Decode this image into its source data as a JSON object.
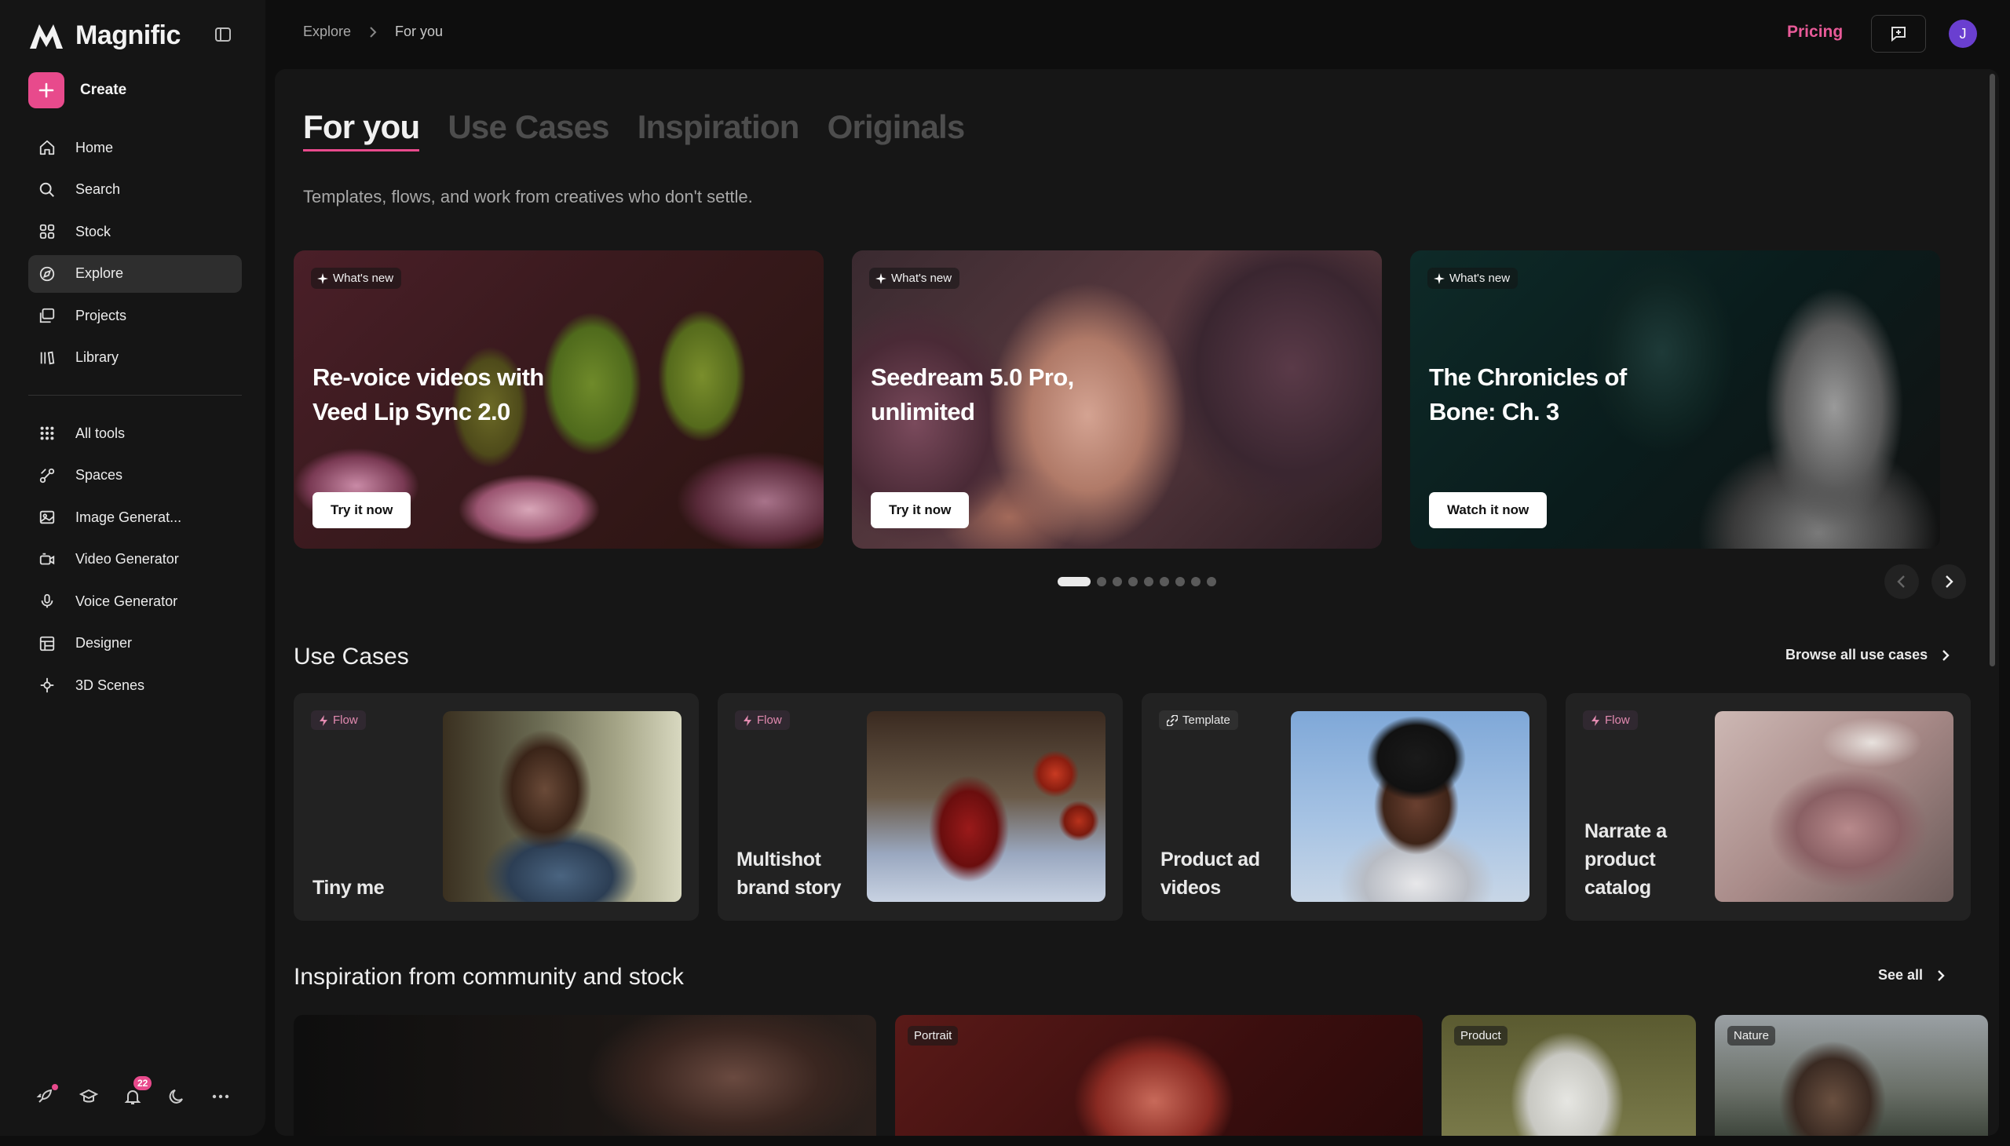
{
  "brand": {
    "name": "Magnific"
  },
  "sidebar": {
    "create_label": "Create",
    "primary": [
      {
        "label": "Home",
        "icon": "home-icon"
      },
      {
        "label": "Search",
        "icon": "search-icon"
      },
      {
        "label": "Stock",
        "icon": "grid-icon"
      },
      {
        "label": "Explore",
        "icon": "explore-icon",
        "active": true
      },
      {
        "label": "Projects",
        "icon": "projects-icon"
      },
      {
        "label": "Library",
        "icon": "library-icon"
      }
    ],
    "tools": [
      {
        "label": "All tools",
        "icon": "apps-icon"
      },
      {
        "label": "Spaces",
        "icon": "spaces-icon"
      },
      {
        "label": "Image Generat...",
        "icon": "image-icon"
      },
      {
        "label": "Video Generator",
        "icon": "video-icon"
      },
      {
        "label": "Voice Generator",
        "icon": "microphone-icon"
      },
      {
        "label": "Designer",
        "icon": "designer-icon"
      },
      {
        "label": "3D Scenes",
        "icon": "cube-icon"
      }
    ],
    "notifications_count": "22"
  },
  "topbar": {
    "breadcrumb": [
      "Explore",
      "For you"
    ],
    "pricing_label": "Pricing",
    "avatar_initial": "J"
  },
  "tabs": [
    "For you",
    "Use Cases",
    "Inspiration",
    "Originals"
  ],
  "subtitle": "Templates, flows, and work from creatives who don't settle.",
  "hero_cards": [
    {
      "badge": "What's new",
      "title": "Re-voice videos with Veed Lip Sync 2.0",
      "button": "Try it now"
    },
    {
      "badge": "What's new",
      "title": "Seedream 5.0 Pro, unlimited",
      "button": "Try it now"
    },
    {
      "badge": "What's new",
      "title": "The Chronicles of Bone: Ch. 3",
      "button": "Watch it now"
    }
  ],
  "carousel": {
    "total_pages": 9,
    "current_page": 1
  },
  "use_cases": {
    "title": "Use Cases",
    "link": "Browse all use cases",
    "cards": [
      {
        "badge": "Flow",
        "title": "Tiny me"
      },
      {
        "badge": "Flow",
        "title": "Multishot brand story"
      },
      {
        "badge": "Template",
        "title": "Product ad videos"
      },
      {
        "badge": "Flow",
        "title": "Narrate a product catalog"
      }
    ]
  },
  "inspiration": {
    "title": "Inspiration from community and stock",
    "link": "See all",
    "tags": [
      "Portrait",
      "Product",
      "Nature"
    ]
  },
  "colors": {
    "accent": "#e84a8c",
    "pricing": "#e85a98",
    "background": "#0e0e0e",
    "surface": "#161616",
    "card": "#222222"
  }
}
